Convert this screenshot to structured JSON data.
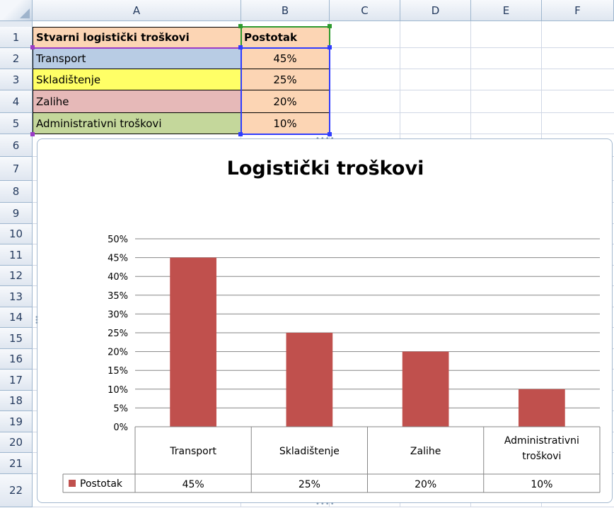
{
  "sheet": {
    "columns": [
      "A",
      "B",
      "C",
      "D",
      "E",
      "F"
    ],
    "rows": [
      "1",
      "2",
      "3",
      "4",
      "5",
      "6",
      "7",
      "8",
      "9",
      "10",
      "11",
      "12",
      "13",
      "14",
      "15",
      "16",
      "17",
      "18",
      "19",
      "20",
      "21",
      "22"
    ],
    "header": {
      "category": "Stvarni logistički troškovi",
      "value": "Postotak"
    },
    "data": [
      {
        "category": "Transport",
        "value": "45%",
        "fill": "#b8cce4"
      },
      {
        "category": "Skladištenje",
        "value": "25%",
        "fill": "#ffff66"
      },
      {
        "category": "Zalihe",
        "value": "20%",
        "fill": "#e6b9b8"
      },
      {
        "category": "Administrativni troškovi",
        "value": "10%",
        "fill": "#c4d79b"
      }
    ],
    "header_fill": "#fcd5b4",
    "value_fill": "#fcd5b4"
  },
  "chart_data": {
    "type": "bar",
    "title": "Logistički troškovi",
    "categories": [
      "Transport",
      "Skladištenje",
      "Zalihe",
      "Administrativni troškovi"
    ],
    "series": [
      {
        "name": "Postotak",
        "values": [
          45,
          25,
          20,
          10
        ],
        "color": "#c0504d"
      }
    ],
    "ylim": [
      0,
      50
    ],
    "yticks": [
      "0%",
      "5%",
      "10%",
      "15%",
      "20%",
      "25%",
      "30%",
      "35%",
      "40%",
      "45%",
      "50%"
    ],
    "data_table": [
      "45%",
      "25%",
      "20%",
      "10%"
    ],
    "grid": true
  }
}
